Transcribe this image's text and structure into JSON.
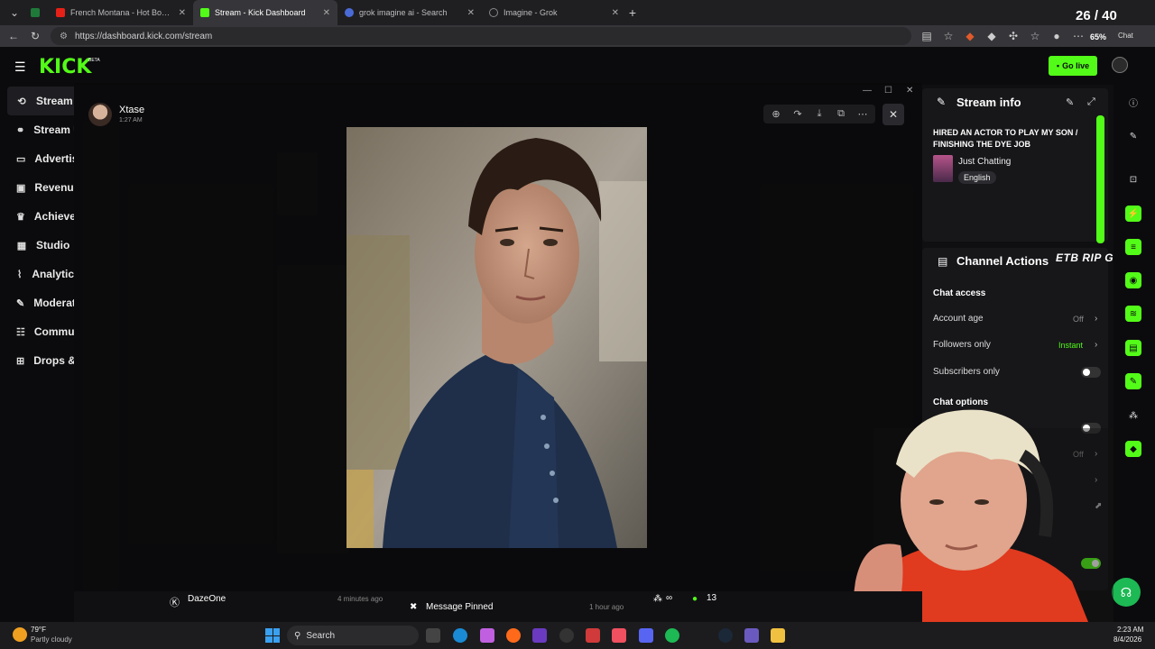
{
  "browser": {
    "tabs": [
      {
        "label": "",
        "color": "#1f7a3a"
      },
      {
        "label": "French Montana - Hot Boy Bling ft.",
        "color": "#e62117"
      },
      {
        "label": "Stream - Kick Dashboard",
        "color": "#53fc18"
      },
      {
        "label": "grok imagine ai - Search",
        "color": "#4a6bd6"
      },
      {
        "label": "Imagine - Grok",
        "color": "#888888"
      }
    ],
    "new_tab": "+",
    "url": "https://dashboard.kick.com/stream",
    "zoom": "65%",
    "chat_label": "Chat"
  },
  "overlay": {
    "counter": "26 / 40"
  },
  "kick": {
    "logo": "KICK",
    "logo_beta": "BETA",
    "go_live": "Go live",
    "accent": "#53fc18"
  },
  "sidebar": {
    "items": [
      {
        "label": "Stream",
        "icon": "stream-icon"
      },
      {
        "label": "Stream U",
        "icon": "link-icon"
      },
      {
        "label": "Advertis",
        "icon": "ad-icon"
      },
      {
        "label": "Revenue",
        "icon": "dollar-icon"
      },
      {
        "label": "Achieve",
        "icon": "trophy-icon"
      },
      {
        "label": "Studio",
        "icon": "studio-icon"
      },
      {
        "label": "Analytic",
        "icon": "chart-icon"
      },
      {
        "label": "Moderat",
        "icon": "shield-icon"
      },
      {
        "label": "Commun",
        "icon": "community-icon"
      },
      {
        "label": "Drops &",
        "icon": "gift-icon"
      }
    ]
  },
  "viewer": {
    "poster_name": "Xtase",
    "poster_time": "1:27 AM"
  },
  "stream_info": {
    "title": "Stream info",
    "stream_title": "HIRED AN ACTOR TO PLAY MY SON / FINISHING THE DYE JOB",
    "category": "Just Chatting",
    "language": "English"
  },
  "channel_actions": {
    "title": "Channel Actions",
    "goal_overlay": "ETB RIP GOAL",
    "chat_access_head": "Chat access",
    "rows": [
      {
        "label": "Account age",
        "value": "Off"
      },
      {
        "label": "Followers only",
        "value": "Instant"
      },
      {
        "label": "Subscribers only",
        "value": ""
      }
    ],
    "chat_options_head": "Chat options",
    "option_values": [
      "Off"
    ]
  },
  "bottom": {
    "user1": "DazeOne",
    "user1_time": "4 minutes ago",
    "pinned": "Message Pinned",
    "pinned_time": "1 hour ago",
    "infinity": "∞",
    "viewers": "13"
  },
  "taskbar": {
    "temp": "79°F",
    "weather": "Partly cloudy",
    "search": "Search",
    "time": "2:23 AM",
    "date": "8/4/2026"
  }
}
